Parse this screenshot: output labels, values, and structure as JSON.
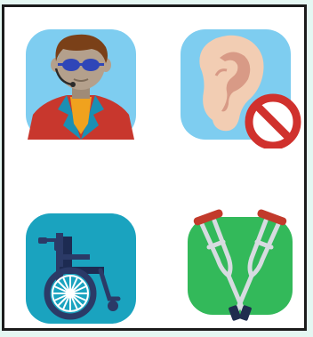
{
  "canvas": {
    "background": "#e4f7f2",
    "frame_color": "#1b1b1b",
    "panel_color": "#ffffff"
  },
  "icons": [
    {
      "name": "blind-person-with-dark-glasses-icon",
      "tile_color": "#7ecdf0",
      "colors": {
        "suit": "#c8372d",
        "shirt": "#f0a21e",
        "skin": "#b4a08c",
        "hair": "#7a4018",
        "glasses": "#2f46b8"
      }
    },
    {
      "name": "deaf-ear-with-prohibited-sign-icon",
      "tile_color": "#7ecdf0",
      "colors": {
        "ear": "#f2cdb3",
        "ear_shade": "#d89a86",
        "sign": "#d0312d"
      }
    },
    {
      "name": "wheelchair-icon",
      "tile_color": "#1aa3bf",
      "colors": {
        "frame": "#2b3a67",
        "seat": "#1d2b52",
        "spokes": "#ffffff"
      }
    },
    {
      "name": "crutches-icon",
      "tile_color": "#33b95a",
      "colors": {
        "crutch": "#d7dbe0",
        "pad": "#c23a2b",
        "tip": "#1f2d4e"
      }
    }
  ]
}
